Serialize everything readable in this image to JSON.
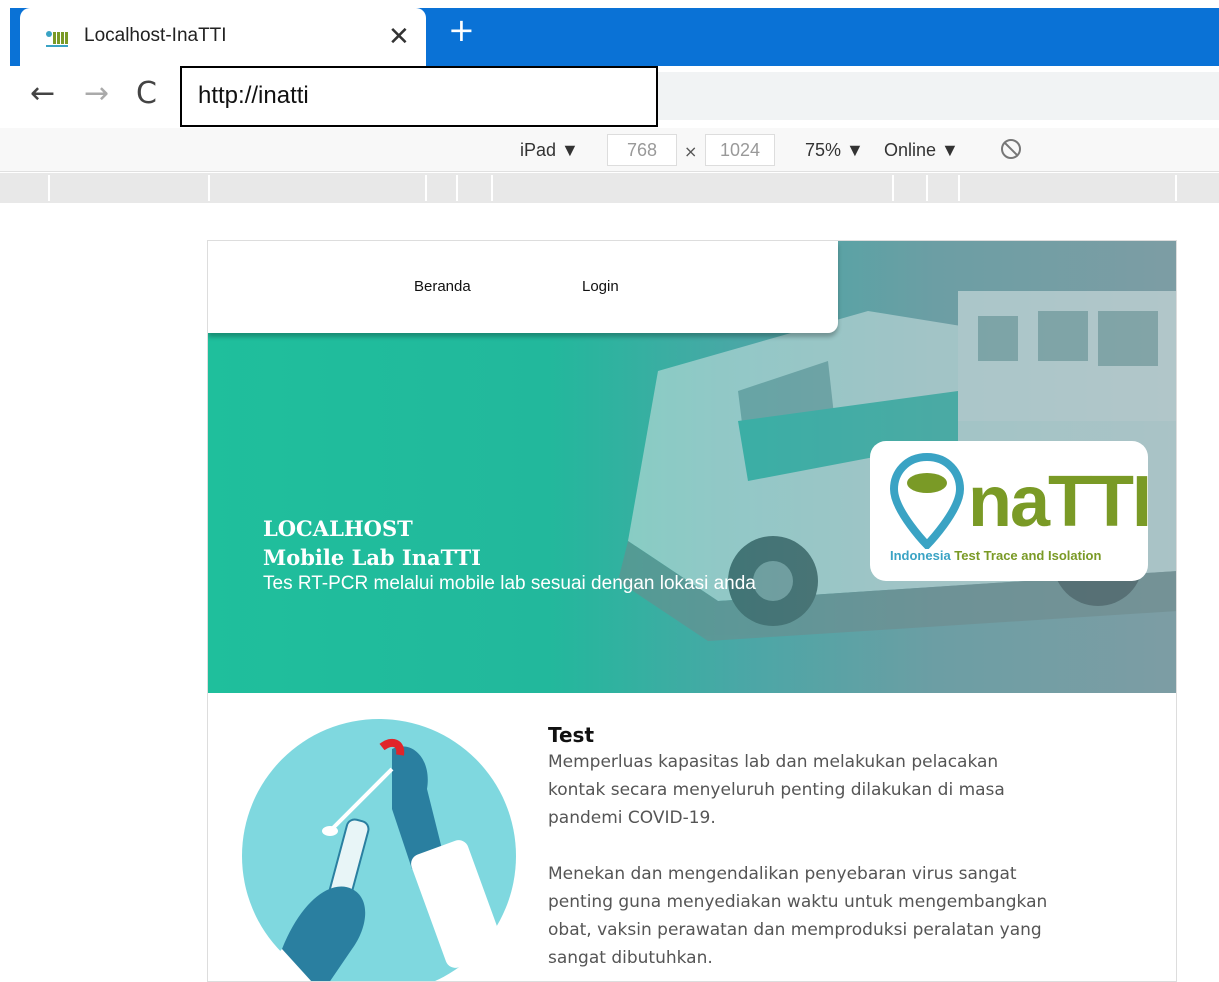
{
  "browser": {
    "tab_title": "Localhost-InaTTI",
    "close_symbol": "✕",
    "new_tab_symbol": "+",
    "url": "http://inatti",
    "back_symbol": "←",
    "forward_symbol": "→",
    "reload_symbol": "C"
  },
  "device_toolbar": {
    "device": "iPad ▼",
    "width": "768",
    "height": "1024",
    "separator": "×",
    "zoom": "75% ▼",
    "network": "Online ▼"
  },
  "page": {
    "nav": {
      "home": "Beranda",
      "login": "Login"
    },
    "hero": {
      "title_line1": "LOCALHOST",
      "title_line2": "Mobile Lab InaTTI",
      "subtitle": "Tes RT-PCR melalui mobile lab sesuai dengan lokasi anda"
    },
    "logo": {
      "brand": "naTTI",
      "tagline_part1": "Indonesia",
      "tagline_part2": " Test Trace and Isolation"
    },
    "test_section": {
      "title": "Test",
      "paragraph1": "Memperluas kapasitas lab dan melakukan pelacakan kontak secara menyeluruh penting dilakukan di masa pandemi COVID-19.",
      "paragraph2": "Menekan dan mengendalikan penyebaran virus sangat penting guna menyediakan waktu untuk mengembangkan obat, vaksin perawatan dan memproduksi peralatan yang sangat dibutuhkan."
    }
  },
  "colors": {
    "chrome_blue": "#0a72d6",
    "hero_teal": "#1fbf9c",
    "logo_green": "#7a9a26",
    "logo_blue": "#3aa3c4"
  }
}
